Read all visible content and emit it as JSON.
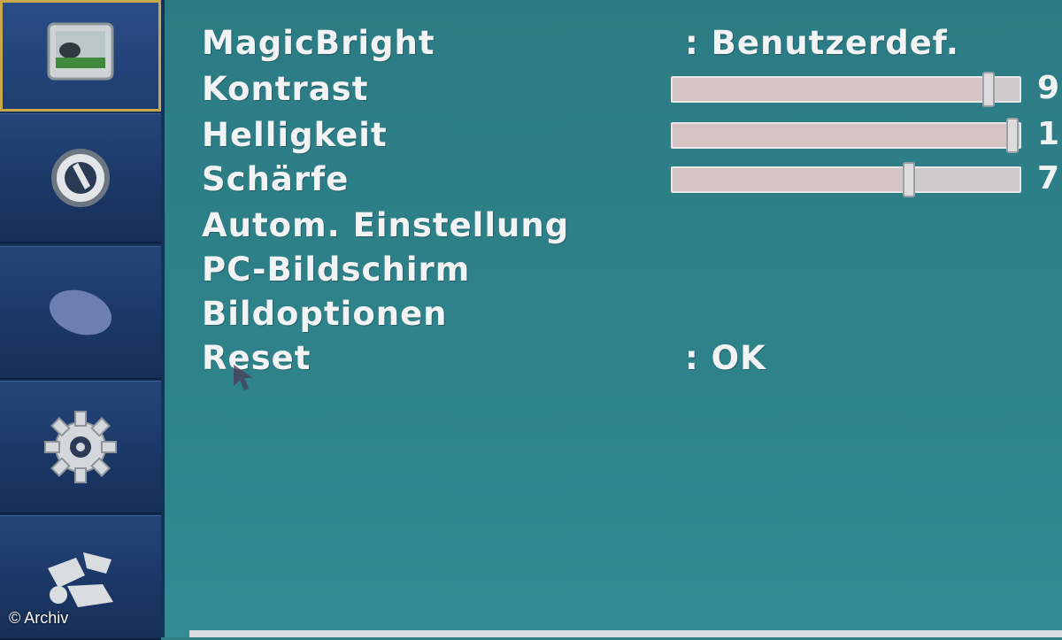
{
  "sidebar": {
    "tabs": [
      {
        "icon": "picture-icon",
        "selected": true
      },
      {
        "icon": "color-icon",
        "selected": false
      },
      {
        "icon": "image-size-icon",
        "selected": false
      },
      {
        "icon": "setup-gear-icon",
        "selected": false
      },
      {
        "icon": "information-icon",
        "selected": false
      }
    ]
  },
  "menu": {
    "items": [
      {
        "label": "MagicBright",
        "value": ": Benutzerdef."
      },
      {
        "label": "Kontrast",
        "slider_value": 0.91,
        "number": "9"
      },
      {
        "label": "Helligkeit",
        "slider_value": 0.98,
        "number": "1"
      },
      {
        "label": "Schärfe",
        "slider_value": 0.68,
        "number": "7"
      },
      {
        "label": "Autom. Einstellung"
      },
      {
        "label": "PC-Bildschirm"
      },
      {
        "label": "Bildoptionen"
      },
      {
        "label": "Reset",
        "value": ": OK"
      }
    ]
  },
  "credit": "© Archiv",
  "colors": {
    "sidebar": "#16325a",
    "background": "#2f7f86",
    "selection": "#c9a84b",
    "text": "#f1f3f4"
  }
}
